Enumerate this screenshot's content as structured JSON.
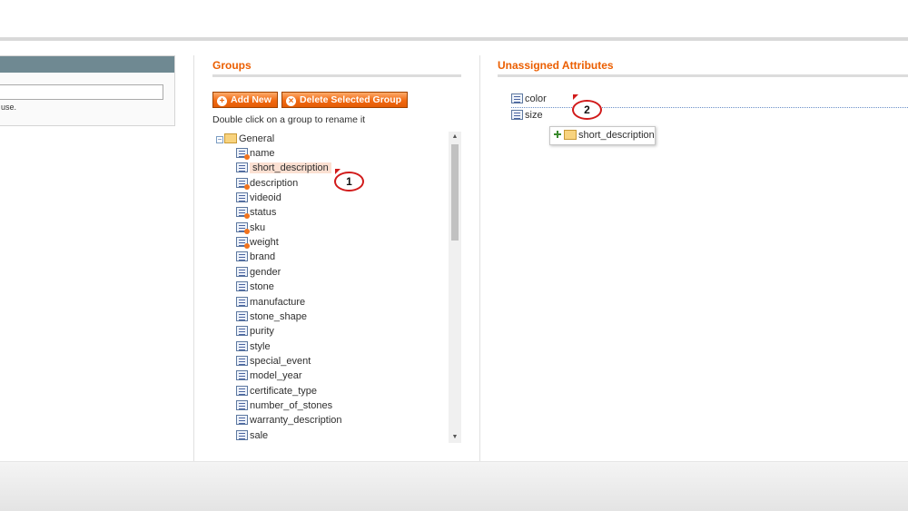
{
  "left_panel": {
    "note": "use."
  },
  "groups": {
    "title": "Groups",
    "add_button": "Add New",
    "delete_button": "Delete Selected Group",
    "hint": "Double click on a group to rename it",
    "root": "General",
    "items": [
      {
        "label": "name",
        "system": true
      },
      {
        "label": "short_description",
        "system": false,
        "selected": true
      },
      {
        "label": "description",
        "system": true
      },
      {
        "label": "videoid",
        "system": false
      },
      {
        "label": "status",
        "system": true
      },
      {
        "label": "sku",
        "system": true
      },
      {
        "label": "weight",
        "system": true
      },
      {
        "label": "brand",
        "system": false
      },
      {
        "label": "gender",
        "system": false
      },
      {
        "label": "stone",
        "system": false
      },
      {
        "label": "manufacture",
        "system": false
      },
      {
        "label": "stone_shape",
        "system": false
      },
      {
        "label": "purity",
        "system": false
      },
      {
        "label": "style",
        "system": false
      },
      {
        "label": "special_event",
        "system": false
      },
      {
        "label": "model_year",
        "system": false
      },
      {
        "label": "certificate_type",
        "system": false
      },
      {
        "label": "number_of_stones",
        "system": false
      },
      {
        "label": "warranty_description",
        "system": false
      },
      {
        "label": "sale",
        "system": false
      }
    ]
  },
  "unassigned": {
    "title": "Unassigned Attributes",
    "items": [
      "color",
      "size"
    ],
    "dragging": "short_description"
  },
  "callouts": {
    "one": "1",
    "two": "2"
  },
  "colors": {
    "accent": "#eb5e00",
    "callout": "#d11a1a",
    "selection": "#fbe0d2"
  }
}
